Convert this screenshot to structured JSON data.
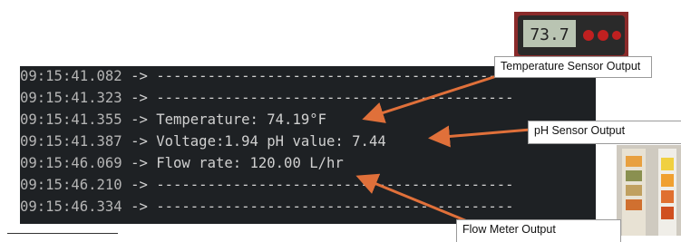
{
  "log_lines": [
    {
      "time": "09:15:41.082",
      "arrow": "->",
      "text": "------------------------------------------"
    },
    {
      "time": "09:15:41.323",
      "arrow": "->",
      "text": "------------------------------------------"
    },
    {
      "time": "09:15:41.355",
      "arrow": "->",
      "text": "Temperature: 74.19°F"
    },
    {
      "time": "09:15:41.387",
      "arrow": "->",
      "text": "Voltage:1.94 pH value: 7.44"
    },
    {
      "time": "09:15:46.069",
      "arrow": "->",
      "text": "Flow rate: 120.00 L/hr"
    },
    {
      "time": "09:15:46.210",
      "arrow": "->",
      "text": "------------------------------------------"
    },
    {
      "time": "09:15:46.334",
      "arrow": "->",
      "text": "------------------------------------------"
    }
  ],
  "callouts": {
    "temperature": "Temperature Sensor Output",
    "ph": "pH Sensor Output",
    "flow": "Flow Meter Output"
  },
  "thermometer_display": "73.7",
  "colors": {
    "terminal_bg": "#1e2124",
    "terminal_text": "#d0d0d0",
    "arrow": "#e0703a"
  }
}
